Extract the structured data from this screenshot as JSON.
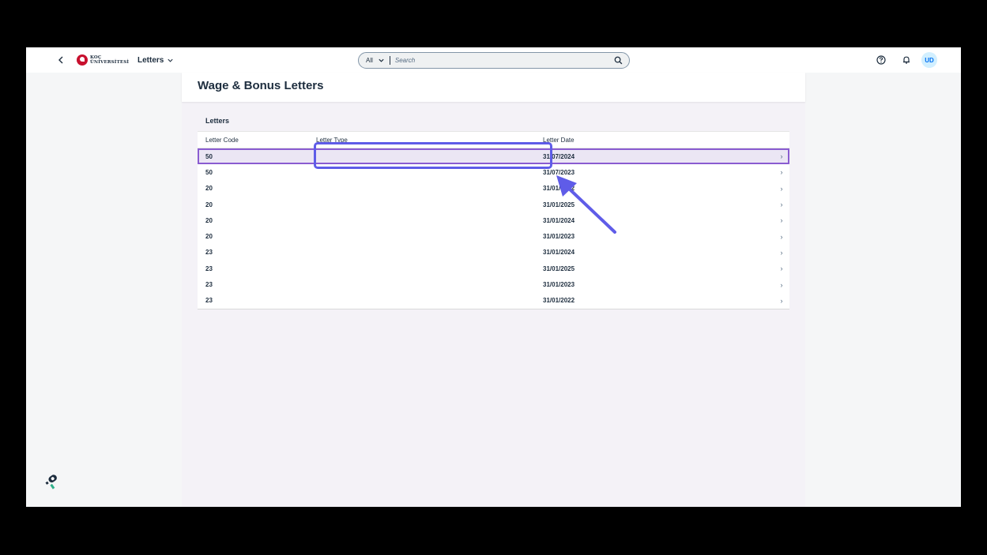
{
  "shell": {
    "app_title": "Letters",
    "logo_line1": "KOÇ",
    "logo_line2": "ÜNİVERSİTESİ",
    "search_scope": "All",
    "search_placeholder": "Search",
    "avatar_initials": "UD"
  },
  "page": {
    "title": "Wage & Bonus Letters"
  },
  "table": {
    "title": "Letters",
    "columns": [
      "Letter Code",
      "Letter Type",
      "Letter Date"
    ],
    "rows": [
      {
        "code": "50",
        "type": "",
        "date": "31/07/2024",
        "selected": true
      },
      {
        "code": "50",
        "type": "",
        "date": "31/07/2023"
      },
      {
        "code": "20",
        "type": "",
        "date": "31/01/2022"
      },
      {
        "code": "20",
        "type": "",
        "date": "31/01/2025"
      },
      {
        "code": "20",
        "type": "",
        "date": "31/01/2024"
      },
      {
        "code": "20",
        "type": "",
        "date": "31/01/2023"
      },
      {
        "code": "23",
        "type": "",
        "date": "31/01/2024"
      },
      {
        "code": "23",
        "type": "",
        "date": "31/01/2025"
      },
      {
        "code": "23",
        "type": "",
        "date": "31/01/2023"
      },
      {
        "code": "23",
        "type": "",
        "date": "31/01/2022"
      }
    ]
  },
  "icons": {
    "back": "chevron-left-icon",
    "app_menu": "chevron-down-icon",
    "search": "search-icon",
    "help": "help-icon",
    "notifications": "bell-icon",
    "row_nav": "chevron-right-icon",
    "helper": "pin-tool-icon"
  },
  "colors": {
    "selection_outline": "#8a5cd1",
    "selection_fill": "#ebe6f4",
    "annotation": "#5f5ce8",
    "avatar_bg": "#d1efff",
    "brand": "#c8102e"
  }
}
